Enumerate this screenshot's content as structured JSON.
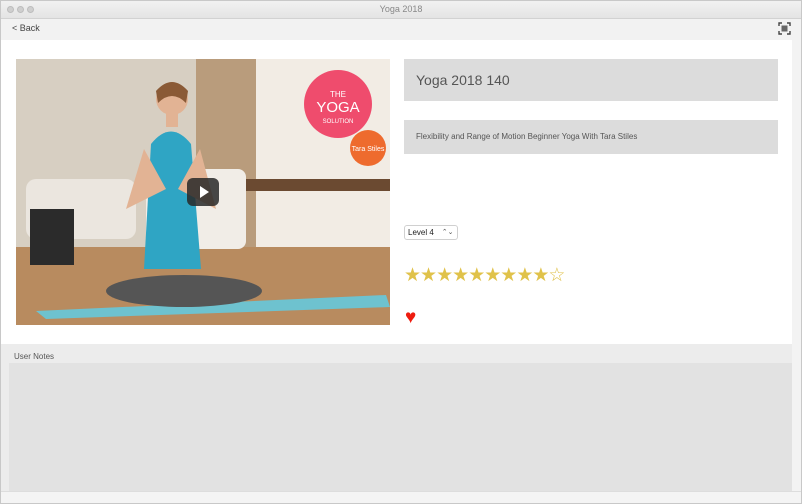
{
  "window": {
    "title": "Yoga 2018"
  },
  "toolbar": {
    "back_label": "< Back",
    "fullscreen_icon": "fullscreen-icon"
  },
  "video": {
    "thumbnail_icon": "yoga-video-thumbnail",
    "play_icon": "play-icon"
  },
  "class_info": {
    "title": "Yoga 2018 140",
    "description": "Flexibility and Range of Motion  Beginner Yoga With Tara Stiles"
  },
  "level": {
    "selected": "Level 4"
  },
  "rating": {
    "filled": 9,
    "total": 10,
    "filled_glyph": "★",
    "empty_glyph": "☆",
    "color": "#e0c24a"
  },
  "favorite": {
    "glyph": "♥",
    "color": "#ee1c0f"
  },
  "notes": {
    "label": "User Notes",
    "value": ""
  }
}
